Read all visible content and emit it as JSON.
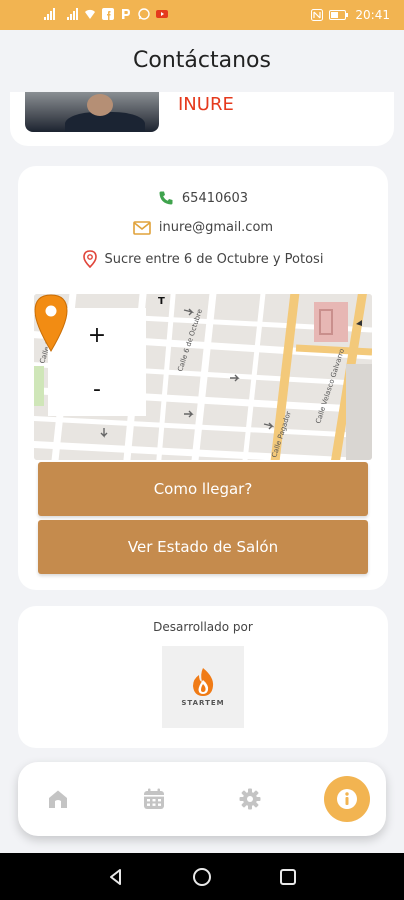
{
  "status_bar": {
    "time": "20:41",
    "left_icons": [
      "signal-icon",
      "signal-icon",
      "wifi-icon",
      "facebook-icon",
      "parking-app-icon",
      "whatsapp-icon",
      "youtube-icon"
    ],
    "right_icons": [
      "nfc-icon",
      "battery-icon"
    ]
  },
  "header": {
    "title": "Contáctanos"
  },
  "venue_card": {
    "name": "INURE"
  },
  "contact": {
    "phone": "65410603",
    "email": "inure@gmail.com",
    "address": "Sucre entre 6 de Octubre y Potosi"
  },
  "map": {
    "zoom_in": "+",
    "zoom_out": "-",
    "street_labels": [
      "Calle 6 de Octubre",
      "Calle Velasco Galvarro",
      "Calle Pagador",
      "Calle Potosi"
    ]
  },
  "actions": {
    "directions": "Como llegar?",
    "salon_status": "Ver Estado de Salón"
  },
  "developer": {
    "label": "Desarrollado por",
    "brand": "STARTEM"
  },
  "bottom_nav": {
    "items": [
      "home-icon",
      "calendar-icon",
      "settings-icon",
      "info-icon"
    ],
    "active": "info-icon"
  },
  "colors": {
    "status_bar": "#f2b451",
    "accent": "#f2b451",
    "button": "#c58b4d",
    "venue_name": "#e53a1d",
    "phone_icon": "#3fa34d",
    "email_icon": "#e0a23a",
    "location_icon": "#e0453a",
    "map_pin": "#f28c13"
  }
}
